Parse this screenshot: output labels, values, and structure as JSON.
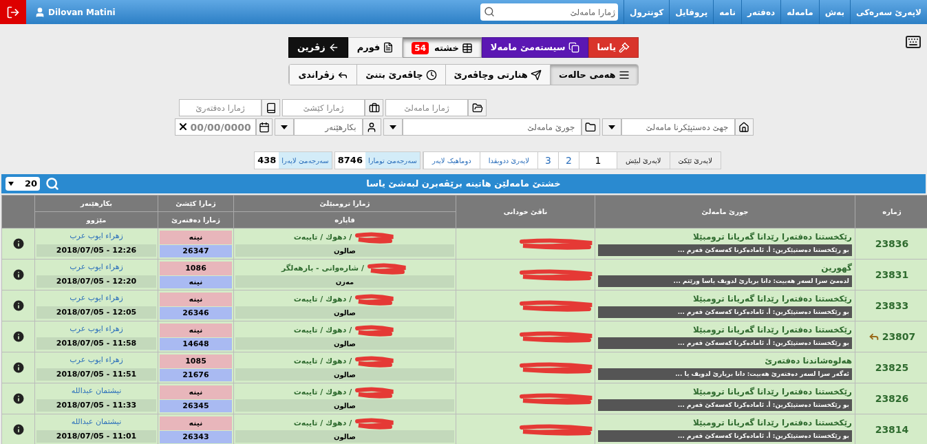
{
  "nav": {
    "items": [
      "لاپەرێ سەرەکی",
      "بەش",
      "مامەلە",
      "دەفتەر",
      "نامە",
      "پروفایل",
      "کونترول"
    ],
    "search": {
      "placeholder": "ژمارا مامەلێ"
    },
    "user": "Dilovan Matini"
  },
  "view_buttons": [
    {
      "label": "یاسا",
      "kind": "danger",
      "selected": false
    },
    {
      "label": "سیستەمێ مامەلا",
      "kind": "primary",
      "selected": false
    },
    {
      "label": "خشتە",
      "kind": "table",
      "badge": "54",
      "selected": true
    },
    {
      "label": "فورم",
      "kind": "form",
      "selected": false
    },
    {
      "label": "زڤرین",
      "kind": "back",
      "selected": false
    }
  ],
  "status_filters": [
    {
      "label": "هەمی حالەت",
      "kind": "all",
      "selected": true
    },
    {
      "label": "هنارتی وچاڤەرێ",
      "kind": "sent",
      "selected": false
    },
    {
      "label": "چاڤەرێ بتنێ",
      "kind": "waiting",
      "selected": false
    },
    {
      "label": "زڤراندی",
      "kind": "returned",
      "selected": false
    }
  ],
  "filters_row_1": [
    {
      "placeholder": "ژمارا مامەلێ",
      "kind": "folder-open"
    },
    {
      "placeholder": "ژمارا کێشێ",
      "kind": "briefcase"
    },
    {
      "placeholder": "ژمارا دەفتەرێ",
      "kind": "book"
    }
  ],
  "filters_row_2": [
    {
      "placeholder": "جهێ دەستپێکرنا مامەلێ",
      "kind": "home"
    },
    {
      "placeholder": "جورێ مامەلێ",
      "kind": "folder"
    },
    {
      "placeholder": "بکارهێنەر",
      "kind": "user"
    }
  ],
  "date_field": {
    "placeholder": "00/00/0000"
  },
  "pagination": {
    "pages": [
      {
        "label": "لاپەرێ ئێکێ",
        "selected": false
      },
      {
        "label": "لاپەرێ لبێش",
        "selected": false
      },
      {
        "label": "1",
        "selected": true
      },
      {
        "label": "2",
        "selected": false
      },
      {
        "label": "3",
        "selected": false
      },
      {
        "label": "لاپەرێ ددویڤدا",
        "selected": false
      },
      {
        "label": "دوماهیک لاپەر",
        "selected": false
      }
    ],
    "totals": [
      {
        "label": "سەرجەمێ تومارا",
        "value": "8746"
      },
      {
        "label": "سەرجەمێ لاپەرا",
        "value": "438"
      }
    ]
  },
  "table": {
    "title": "خشتێ مامەلێن هاتینە برێڤەبرن لبەشێ یاسا",
    "page_size": "20",
    "columns": [
      "ژمارە",
      "جورێ مامەلێ",
      "ناڤێ خودانی",
      [
        "ژمارا ترومبێلێ",
        "قاپارە"
      ],
      [
        "ژمارا کێشێ",
        "ژمارا دەفتەرێ"
      ],
      [
        "بکارهێنەر",
        "مێژوو"
      ]
    ],
    "rows": [
      {
        "id": "23836",
        "returned": false,
        "type": "رێکخستنا دەفتەرا رێدانا گەریانا ترومبێلا",
        "note": "بو رێکخستنا دەستپێکرین: أ. ئامادەکرنا کەسەکێ قەرم ...",
        "plate": "/ دهوك / تايبەت",
        "body": "صالون",
        "weight": "نينە",
        "book": "26347",
        "user": "زهراء ايوب عرب",
        "date": "2018/07/05 - 12:26"
      },
      {
        "id": "23831",
        "returned": false,
        "type": "گهورین",
        "note": "لدەمێ سزا لسەر هەبیت: دانا بریارێ لدویف یاسا ورێتم ...",
        "plate": "/ شارەوانی - بارهەلگر",
        "body": "مەزن",
        "weight": "1086",
        "book": "نينە",
        "user": "زهراء ايوب عرب",
        "date": "2018/07/05 - 12:20"
      },
      {
        "id": "23833",
        "returned": false,
        "type": "رێکخستنا دەفتەرا رێدانا گەریانا ترومبێلا",
        "note": "بو رێکخستنا دەستپێکرین: أ. ئامادەکرنا کەسەکێ قەرم ...",
        "plate": "/ دهوك / تايبەت",
        "body": "صالون",
        "weight": "نينە",
        "book": "26346",
        "user": "زهراء ايوب عرب",
        "date": "2018/07/05 - 12:05"
      },
      {
        "id": "23807",
        "returned": true,
        "type": "رێکخستنا دەفتەرا رێدانا گەریانا ترومبێلا",
        "note": "بو رێکخستنا دەستپێکرین: أ. ئامادەکرنا کەسەکێ قەرم ...",
        "plate": "/ دهوك / تايبەت",
        "body": "صالون",
        "weight": "نينە",
        "book": "14648",
        "user": "زهراء ايوب عرب",
        "date": "2018/07/05 - 11:58"
      },
      {
        "id": "23825",
        "returned": false,
        "type": "هەلوەشاندنا دەفتەرێ",
        "note": "ئەگەر سزا لسەر دەفتەرێ هەبیت: دانا بریارێ لدویف یا ...",
        "plate": "/ دهوك / تايبەت",
        "body": "صالون",
        "weight": "1085",
        "book": "21676",
        "user": "زهراء ايوب عرب",
        "date": "2018/07/05 - 11:51"
      },
      {
        "id": "23826",
        "returned": false,
        "type": "رێکخستنا دەفتەرا رێدانا گەریانا ترومبێلا",
        "note": "بو رێکخستنا دەستپێکرین: أ. ئامادەکرنا کەسەکێ قەرم ...",
        "plate": "/ دهوك / تايبەت",
        "body": "صالون",
        "weight": "نينە",
        "book": "26345",
        "user": "نيشتمان عبدالله",
        "date": "2018/07/05 - 11:33"
      },
      {
        "id": "23814",
        "returned": false,
        "type": "رێکخستنا دەفتەرا رێدانا گەریانا ترومبێلا",
        "note": "بو رێکخستنا دەستپێکرین: أ. ئامادەکرنا کەسەکێ قەرم ...",
        "plate": "/ دهوك / تايبەت",
        "body": "صالون",
        "weight": "نينە",
        "book": "26343",
        "user": "نيشتمان عبدالله",
        "date": "2018/07/05 - 11:01"
      }
    ]
  }
}
